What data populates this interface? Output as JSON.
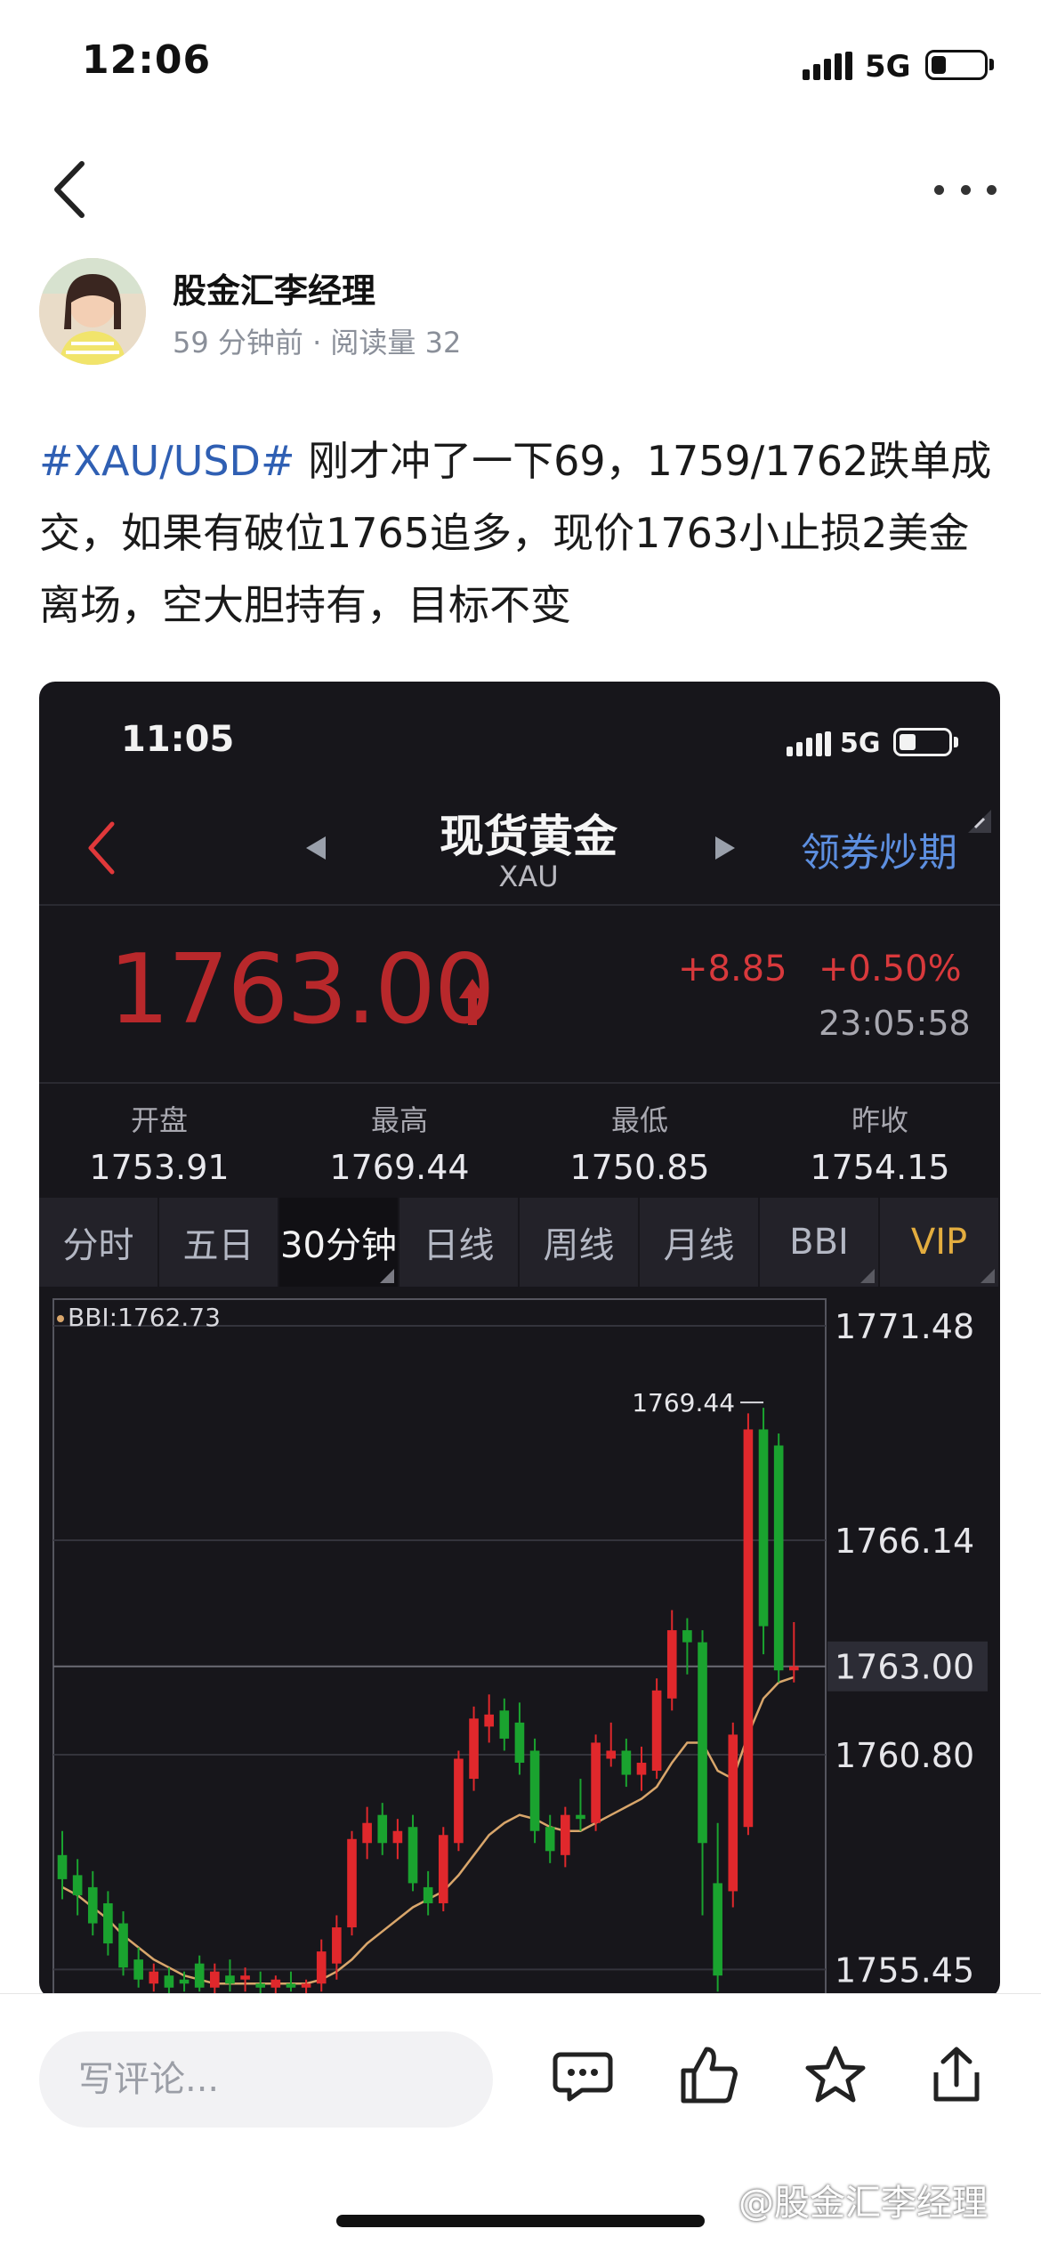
{
  "status_bar": {
    "time": "12:06",
    "network": "5G"
  },
  "author": {
    "name": "股金汇李经理",
    "time_ago": "59 分钟前",
    "separator": "·",
    "reads_label": "阅读量",
    "reads": "32"
  },
  "post": {
    "hashtag": "#XAU/USD#",
    "text": " 刚才冲了一下69，1759/1762跌单成交，如果有破位1765追多，现价1763小止损2美金离场，空大胆持有，目标不变"
  },
  "embed": {
    "status_time": "11:05",
    "network": "5G",
    "title": "现货黄金",
    "subtitle": "XAU",
    "coupon_link": "领券炒期",
    "price": "1763.00",
    "change": "+8.85",
    "change_pct": "+0.50%",
    "update_time": "23:05:58",
    "stats": [
      {
        "label": "开盘",
        "value": "1753.91"
      },
      {
        "label": "最高",
        "value": "1769.44"
      },
      {
        "label": "最低",
        "value": "1750.85"
      },
      {
        "label": "昨收",
        "value": "1754.15"
      }
    ],
    "tabs": [
      {
        "label": "分时"
      },
      {
        "label": "五日"
      },
      {
        "label": "30分钟"
      },
      {
        "label": "日线"
      },
      {
        "label": "周线"
      },
      {
        "label": "月线"
      },
      {
        "label": "BBI"
      },
      {
        "label": "VIP"
      }
    ],
    "active_tab": "30分钟",
    "colors": {
      "up": "#e0282c",
      "down": "#1aa32f",
      "bbi_line": "#d9a66b",
      "accent": "#5d8fe0",
      "vip": "#e3ad3f"
    }
  },
  "chart_data": {
    "type": "candlestick",
    "indicator_label": "BBI:1762.73",
    "y_ticks": [
      "1771.48",
      "1766.14",
      "1763.00",
      "1760.80",
      "1755.45"
    ],
    "current_price_label": "1763.00",
    "high_annotation": "1769.44",
    "ylim": [
      1754.9,
      1772.0
    ],
    "candles": [
      {
        "o": 1758.3,
        "h": 1758.9,
        "l": 1757.2,
        "c": 1757.7
      },
      {
        "o": 1757.8,
        "h": 1758.2,
        "l": 1756.8,
        "c": 1757.3
      },
      {
        "o": 1757.5,
        "h": 1757.9,
        "l": 1756.3,
        "c": 1756.6
      },
      {
        "o": 1757.1,
        "h": 1757.4,
        "l": 1755.8,
        "c": 1756.1
      },
      {
        "o": 1756.6,
        "h": 1756.9,
        "l": 1755.3,
        "c": 1755.5
      },
      {
        "o": 1755.7,
        "h": 1756.0,
        "l": 1755.0,
        "c": 1755.2
      },
      {
        "o": 1755.1,
        "h": 1755.6,
        "l": 1754.9,
        "c": 1755.4
      },
      {
        "o": 1755.3,
        "h": 1755.5,
        "l": 1754.8,
        "c": 1755.0
      },
      {
        "o": 1755.2,
        "h": 1755.4,
        "l": 1754.9,
        "c": 1755.1
      },
      {
        "o": 1755.6,
        "h": 1755.8,
        "l": 1754.9,
        "c": 1755.0
      },
      {
        "o": 1755.0,
        "h": 1755.6,
        "l": 1754.8,
        "c": 1755.4
      },
      {
        "o": 1755.3,
        "h": 1755.7,
        "l": 1754.9,
        "c": 1755.1
      },
      {
        "o": 1755.2,
        "h": 1755.5,
        "l": 1754.9,
        "c": 1755.3
      },
      {
        "o": 1755.1,
        "h": 1755.4,
        "l": 1754.8,
        "c": 1755.0
      },
      {
        "o": 1755.0,
        "h": 1755.3,
        "l": 1754.8,
        "c": 1755.2
      },
      {
        "o": 1755.1,
        "h": 1755.4,
        "l": 1754.9,
        "c": 1755.0
      },
      {
        "o": 1755.0,
        "h": 1755.2,
        "l": 1754.8,
        "c": 1755.1
      },
      {
        "o": 1755.1,
        "h": 1756.2,
        "l": 1754.9,
        "c": 1755.9
      },
      {
        "o": 1755.6,
        "h": 1756.8,
        "l": 1755.2,
        "c": 1756.5
      },
      {
        "o": 1756.5,
        "h": 1758.9,
        "l": 1756.3,
        "c": 1758.7
      },
      {
        "o": 1758.6,
        "h": 1759.5,
        "l": 1758.2,
        "c": 1759.1
      },
      {
        "o": 1759.3,
        "h": 1759.6,
        "l": 1758.3,
        "c": 1758.6
      },
      {
        "o": 1758.6,
        "h": 1759.2,
        "l": 1758.2,
        "c": 1758.9
      },
      {
        "o": 1759.0,
        "h": 1759.3,
        "l": 1757.4,
        "c": 1757.6
      },
      {
        "o": 1757.5,
        "h": 1757.9,
        "l": 1756.8,
        "c": 1757.1
      },
      {
        "o": 1757.1,
        "h": 1759.0,
        "l": 1756.9,
        "c": 1758.8
      },
      {
        "o": 1758.6,
        "h": 1760.9,
        "l": 1758.4,
        "c": 1760.7
      },
      {
        "o": 1760.2,
        "h": 1762.0,
        "l": 1759.9,
        "c": 1761.7
      },
      {
        "o": 1761.5,
        "h": 1762.3,
        "l": 1761.1,
        "c": 1761.8
      },
      {
        "o": 1761.9,
        "h": 1762.2,
        "l": 1760.9,
        "c": 1761.2
      },
      {
        "o": 1761.6,
        "h": 1762.1,
        "l": 1760.3,
        "c": 1760.6
      },
      {
        "o": 1760.9,
        "h": 1761.2,
        "l": 1758.6,
        "c": 1758.9
      },
      {
        "o": 1759.0,
        "h": 1759.3,
        "l": 1758.1,
        "c": 1758.4
      },
      {
        "o": 1758.3,
        "h": 1759.5,
        "l": 1758.0,
        "c": 1759.3
      },
      {
        "o": 1759.3,
        "h": 1760.2,
        "l": 1758.9,
        "c": 1759.2
      },
      {
        "o": 1759.1,
        "h": 1761.3,
        "l": 1758.9,
        "c": 1761.1
      },
      {
        "o": 1760.7,
        "h": 1761.6,
        "l": 1760.5,
        "c": 1760.9
      },
      {
        "o": 1760.9,
        "h": 1761.2,
        "l": 1760.0,
        "c": 1760.3
      },
      {
        "o": 1760.3,
        "h": 1761.0,
        "l": 1759.9,
        "c": 1760.6
      },
      {
        "o": 1760.4,
        "h": 1762.7,
        "l": 1760.2,
        "c": 1762.4
      },
      {
        "o": 1762.2,
        "h": 1764.4,
        "l": 1761.9,
        "c": 1763.9
      },
      {
        "o": 1763.9,
        "h": 1764.2,
        "l": 1762.8,
        "c": 1763.6
      },
      {
        "o": 1763.6,
        "h": 1763.9,
        "l": 1756.8,
        "c": 1758.6
      },
      {
        "o": 1757.6,
        "h": 1759.1,
        "l": 1754.9,
        "c": 1755.3
      },
      {
        "o": 1757.4,
        "h": 1761.6,
        "l": 1757.0,
        "c": 1761.3
      },
      {
        "o": 1759.0,
        "h": 1769.3,
        "l": 1758.8,
        "c": 1768.9
      },
      {
        "o": 1768.9,
        "h": 1769.44,
        "l": 1763.3,
        "c": 1764.0
      },
      {
        "o": 1768.5,
        "h": 1768.8,
        "l": 1762.6,
        "c": 1762.9
      },
      {
        "o": 1762.9,
        "h": 1764.1,
        "l": 1762.6,
        "c": 1763.0
      }
    ],
    "bbi": [
      1757.5,
      1757.3,
      1757.0,
      1756.7,
      1756.3,
      1756.0,
      1755.7,
      1755.5,
      1755.3,
      1755.2,
      1755.1,
      1755.1,
      1755.1,
      1755.1,
      1755.1,
      1755.1,
      1755.1,
      1755.2,
      1755.4,
      1755.7,
      1756.1,
      1756.4,
      1756.7,
      1757.0,
      1757.2,
      1757.4,
      1757.8,
      1758.3,
      1758.8,
      1759.1,
      1759.3,
      1759.2,
      1759.0,
      1758.9,
      1758.9,
      1759.1,
      1759.3,
      1759.5,
      1759.7,
      1760.0,
      1760.6,
      1761.1,
      1761.1,
      1760.4,
      1760.2,
      1761.3,
      1762.2,
      1762.6,
      1762.73
    ]
  },
  "bottom_bar": {
    "comment_placeholder": "写评论...",
    "watermark": "@股金汇李经理"
  }
}
